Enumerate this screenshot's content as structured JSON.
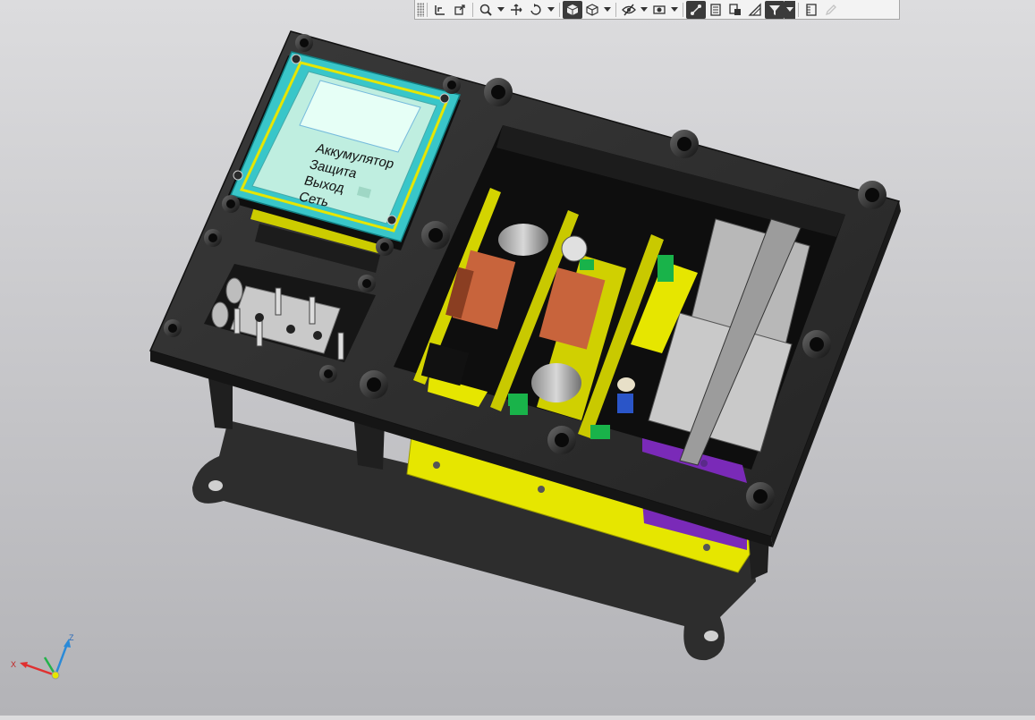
{
  "display": {
    "menu": [
      "Аккумулятор",
      "Защита",
      "Выход",
      "Сеть"
    ]
  },
  "axes": {
    "x": "X",
    "y": "Y",
    "z": "Z"
  },
  "toolbar": {
    "buttons": [
      {
        "icon": "grip-icon"
      },
      {
        "icon": "orientation-icon"
      },
      {
        "icon": "normal-to-icon"
      },
      {
        "icon": "zoom-icon"
      },
      {
        "icon": "pan-icon"
      },
      {
        "icon": "rotate-icon"
      },
      {
        "icon": "shaded-cube-icon",
        "active": true
      },
      {
        "icon": "wireframe-cube-icon"
      },
      {
        "icon": "hide-icon"
      },
      {
        "icon": "section-view-icon"
      },
      {
        "icon": "snap-icon",
        "active": true
      },
      {
        "icon": "layers-icon"
      },
      {
        "icon": "component-icon"
      },
      {
        "icon": "filter-icon",
        "active": true
      },
      {
        "icon": "properties-icon"
      },
      {
        "icon": "edit-pencil-icon",
        "disabled": true
      }
    ]
  },
  "colors": {
    "frame": "#2b2b2b",
    "pcb_yellow": "#e6e600",
    "display_bezel": "#39c6c9",
    "display_screen": "#bfeee0",
    "purple": "#7a2ab8",
    "transformer": "#c8643c"
  }
}
